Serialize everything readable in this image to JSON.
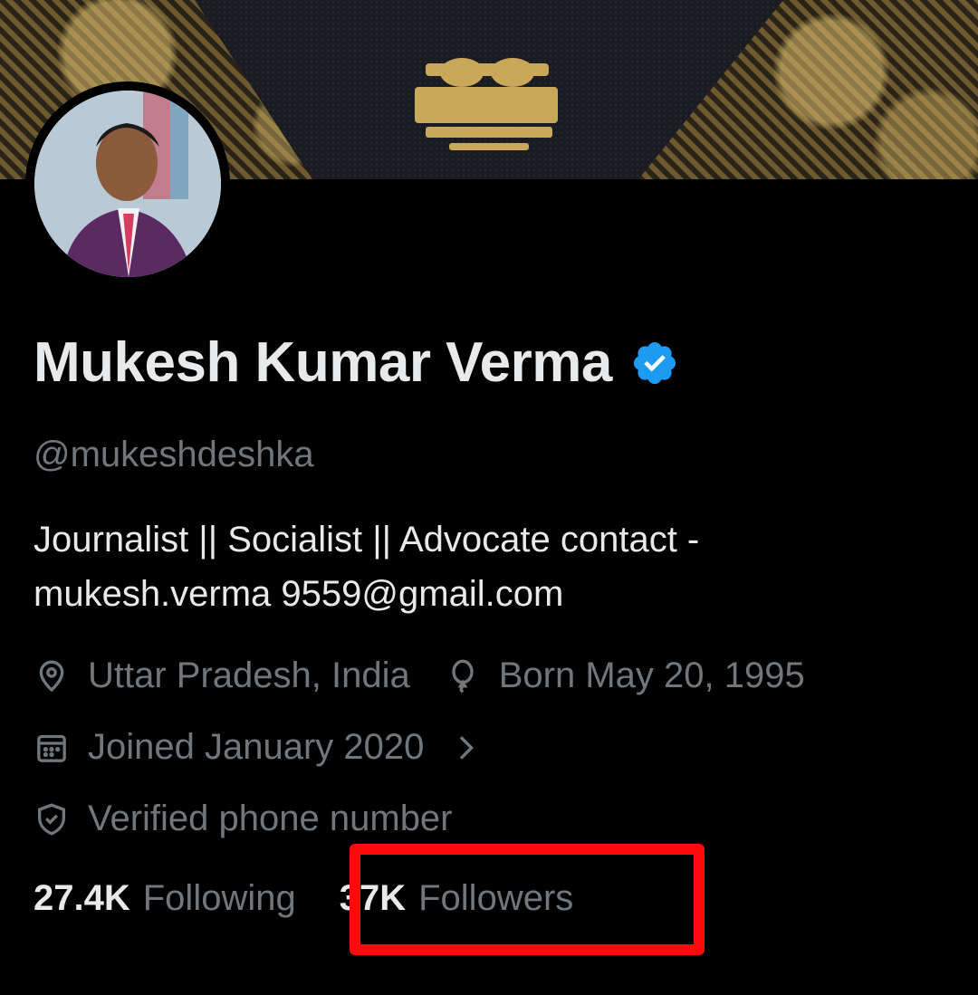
{
  "profile": {
    "name": "Mukesh Kumar Verma",
    "handle": "@mukeshdeshka",
    "bio": "Journalist || Socialist || Advocate  contact -\nmukesh.verma 9559@gmail.com",
    "verified_icon": "verified-badge-icon",
    "accent_color": "#1d9bf0"
  },
  "meta": {
    "location": "Uttar Pradesh, India",
    "birthday": "Born May 20, 1995",
    "joined": "Joined January 2020",
    "phone": "Verified phone number"
  },
  "stats": {
    "following_count": "27.4K",
    "following_label": "Following",
    "followers_count": "37K",
    "followers_label": "Followers"
  },
  "annotation_color": "#ff0a0a"
}
